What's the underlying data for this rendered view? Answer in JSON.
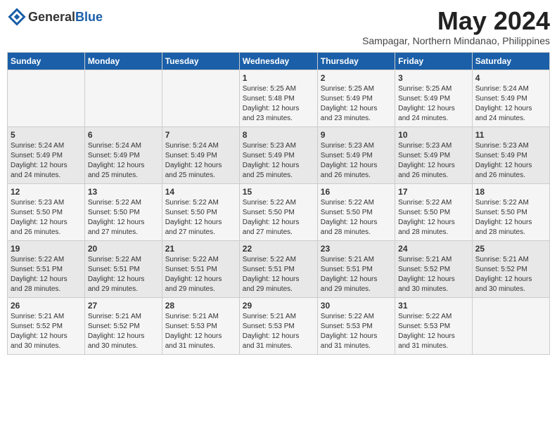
{
  "header": {
    "logo_general": "General",
    "logo_blue": "Blue",
    "month_year": "May 2024",
    "location": "Sampagar, Northern Mindanao, Philippines"
  },
  "days_of_week": [
    "Sunday",
    "Monday",
    "Tuesday",
    "Wednesday",
    "Thursday",
    "Friday",
    "Saturday"
  ],
  "weeks": [
    [
      {
        "day": "",
        "info": ""
      },
      {
        "day": "",
        "info": ""
      },
      {
        "day": "",
        "info": ""
      },
      {
        "day": "1",
        "info": "Sunrise: 5:25 AM\nSunset: 5:48 PM\nDaylight: 12 hours\nand 23 minutes."
      },
      {
        "day": "2",
        "info": "Sunrise: 5:25 AM\nSunset: 5:49 PM\nDaylight: 12 hours\nand 23 minutes."
      },
      {
        "day": "3",
        "info": "Sunrise: 5:25 AM\nSunset: 5:49 PM\nDaylight: 12 hours\nand 24 minutes."
      },
      {
        "day": "4",
        "info": "Sunrise: 5:24 AM\nSunset: 5:49 PM\nDaylight: 12 hours\nand 24 minutes."
      }
    ],
    [
      {
        "day": "5",
        "info": "Sunrise: 5:24 AM\nSunset: 5:49 PM\nDaylight: 12 hours\nand 24 minutes."
      },
      {
        "day": "6",
        "info": "Sunrise: 5:24 AM\nSunset: 5:49 PM\nDaylight: 12 hours\nand 25 minutes."
      },
      {
        "day": "7",
        "info": "Sunrise: 5:24 AM\nSunset: 5:49 PM\nDaylight: 12 hours\nand 25 minutes."
      },
      {
        "day": "8",
        "info": "Sunrise: 5:23 AM\nSunset: 5:49 PM\nDaylight: 12 hours\nand 25 minutes."
      },
      {
        "day": "9",
        "info": "Sunrise: 5:23 AM\nSunset: 5:49 PM\nDaylight: 12 hours\nand 26 minutes."
      },
      {
        "day": "10",
        "info": "Sunrise: 5:23 AM\nSunset: 5:49 PM\nDaylight: 12 hours\nand 26 minutes."
      },
      {
        "day": "11",
        "info": "Sunrise: 5:23 AM\nSunset: 5:49 PM\nDaylight: 12 hours\nand 26 minutes."
      }
    ],
    [
      {
        "day": "12",
        "info": "Sunrise: 5:23 AM\nSunset: 5:50 PM\nDaylight: 12 hours\nand 26 minutes."
      },
      {
        "day": "13",
        "info": "Sunrise: 5:22 AM\nSunset: 5:50 PM\nDaylight: 12 hours\nand 27 minutes."
      },
      {
        "day": "14",
        "info": "Sunrise: 5:22 AM\nSunset: 5:50 PM\nDaylight: 12 hours\nand 27 minutes."
      },
      {
        "day": "15",
        "info": "Sunrise: 5:22 AM\nSunset: 5:50 PM\nDaylight: 12 hours\nand 27 minutes."
      },
      {
        "day": "16",
        "info": "Sunrise: 5:22 AM\nSunset: 5:50 PM\nDaylight: 12 hours\nand 28 minutes."
      },
      {
        "day": "17",
        "info": "Sunrise: 5:22 AM\nSunset: 5:50 PM\nDaylight: 12 hours\nand 28 minutes."
      },
      {
        "day": "18",
        "info": "Sunrise: 5:22 AM\nSunset: 5:50 PM\nDaylight: 12 hours\nand 28 minutes."
      }
    ],
    [
      {
        "day": "19",
        "info": "Sunrise: 5:22 AM\nSunset: 5:51 PM\nDaylight: 12 hours\nand 28 minutes."
      },
      {
        "day": "20",
        "info": "Sunrise: 5:22 AM\nSunset: 5:51 PM\nDaylight: 12 hours\nand 29 minutes."
      },
      {
        "day": "21",
        "info": "Sunrise: 5:22 AM\nSunset: 5:51 PM\nDaylight: 12 hours\nand 29 minutes."
      },
      {
        "day": "22",
        "info": "Sunrise: 5:22 AM\nSunset: 5:51 PM\nDaylight: 12 hours\nand 29 minutes."
      },
      {
        "day": "23",
        "info": "Sunrise: 5:21 AM\nSunset: 5:51 PM\nDaylight: 12 hours\nand 29 minutes."
      },
      {
        "day": "24",
        "info": "Sunrise: 5:21 AM\nSunset: 5:52 PM\nDaylight: 12 hours\nand 30 minutes."
      },
      {
        "day": "25",
        "info": "Sunrise: 5:21 AM\nSunset: 5:52 PM\nDaylight: 12 hours\nand 30 minutes."
      }
    ],
    [
      {
        "day": "26",
        "info": "Sunrise: 5:21 AM\nSunset: 5:52 PM\nDaylight: 12 hours\nand 30 minutes."
      },
      {
        "day": "27",
        "info": "Sunrise: 5:21 AM\nSunset: 5:52 PM\nDaylight: 12 hours\nand 30 minutes."
      },
      {
        "day": "28",
        "info": "Sunrise: 5:21 AM\nSunset: 5:53 PM\nDaylight: 12 hours\nand 31 minutes."
      },
      {
        "day": "29",
        "info": "Sunrise: 5:21 AM\nSunset: 5:53 PM\nDaylight: 12 hours\nand 31 minutes."
      },
      {
        "day": "30",
        "info": "Sunrise: 5:22 AM\nSunset: 5:53 PM\nDaylight: 12 hours\nand 31 minutes."
      },
      {
        "day": "31",
        "info": "Sunrise: 5:22 AM\nSunset: 5:53 PM\nDaylight: 12 hours\nand 31 minutes."
      },
      {
        "day": "",
        "info": ""
      }
    ]
  ]
}
